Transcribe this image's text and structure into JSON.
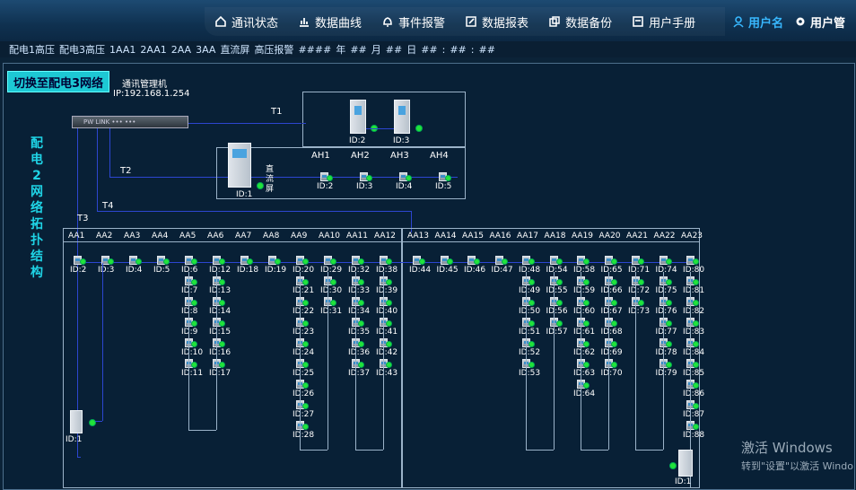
{
  "nav": [
    {
      "label": "通讯状态",
      "icon": "home-icon"
    },
    {
      "label": "数据曲线",
      "icon": "chart-icon"
    },
    {
      "label": "事件报警",
      "icon": "bell-icon"
    },
    {
      "label": "数据报表",
      "icon": "edit-icon"
    },
    {
      "label": "数据备份",
      "icon": "copy-icon"
    },
    {
      "label": "用户手册",
      "icon": "book-icon"
    }
  ],
  "user": {
    "name": "用户名",
    "manage": "用户管"
  },
  "subbar": [
    "配电1高压",
    "配电3高压",
    "1AA1",
    "2AA1",
    "2AA",
    "3AA",
    "直流屏",
    "高压报警",
    "####",
    "年",
    "##",
    "月",
    "##",
    "日",
    "##",
    ":",
    "##",
    ":",
    "##"
  ],
  "switch_button": "切换至配电3网络",
  "title_vertical": "配电2网络拓扑结构",
  "comm": {
    "name": "通讯管理机",
    "ip": "IP:192.168.1.254",
    "device_text": "PW LINK ••• •••"
  },
  "trunks": [
    "T1",
    "T2",
    "T3",
    "T4"
  ],
  "t1_cabinets": [
    "ID:2",
    "ID:3"
  ],
  "ah": [
    "AH1",
    "AH2",
    "AH3",
    "AH4"
  ],
  "ah_ids": [
    "ID:2",
    "ID:3",
    "ID:4",
    "ID:5"
  ],
  "dc": {
    "id": "ID:1",
    "label": "直流屏"
  },
  "aa_headers": [
    "AA1",
    "AA2",
    "AA3",
    "AA4",
    "AA5",
    "AA6",
    "AA7",
    "AA8",
    "AA9",
    "AA10",
    "AA11",
    "AA12",
    "AA13",
    "AA14",
    "AA15",
    "AA16",
    "AA17",
    "AA18",
    "AA19",
    "AA20",
    "AA21",
    "AA22",
    "AA23"
  ],
  "aa_columns": [
    [
      "ID:2"
    ],
    [
      "ID:3"
    ],
    [
      "ID:4"
    ],
    [
      "ID:5"
    ],
    [
      "ID:6",
      "ID:7",
      "ID:8",
      "ID:9",
      "ID:10",
      "ID:11"
    ],
    [
      "ID:12",
      "ID:13",
      "ID:14",
      "ID:15",
      "ID:16",
      "ID:17"
    ],
    [
      "ID:18"
    ],
    [
      "ID:19"
    ],
    [
      "ID:20",
      "ID:21",
      "ID:22",
      "ID:23",
      "ID:24",
      "ID:25",
      "ID:26",
      "ID:27",
      "ID:28"
    ],
    [
      "ID:29",
      "ID:30",
      "ID:31"
    ],
    [
      "ID:32",
      "ID:33",
      "ID:34",
      "ID:35",
      "ID:36",
      "ID:37"
    ],
    [
      "ID:38",
      "ID:39",
      "ID:40",
      "ID:41",
      "ID:42",
      "ID:43"
    ],
    [
      "ID:44"
    ],
    [
      "ID:45"
    ],
    [
      "ID:46"
    ],
    [
      "ID:47"
    ],
    [
      "ID:48",
      "ID:49",
      "ID:50",
      "ID:51",
      "ID:52",
      "ID:53"
    ],
    [
      "ID:54",
      "ID:55",
      "ID:56",
      "ID:57"
    ],
    [
      "ID:58",
      "ID:59",
      "ID:60",
      "ID:61",
      "ID:62",
      "ID:63",
      "ID:64"
    ],
    [
      "ID:65",
      "ID:66",
      "ID:67",
      "ID:68",
      "ID:69",
      "ID:70"
    ],
    [
      "ID:71",
      "ID:72",
      "ID:73"
    ],
    [
      "ID:74",
      "ID:75",
      "ID:76",
      "ID:77",
      "ID:78",
      "ID:79"
    ],
    [
      "ID:80",
      "ID:81",
      "ID:82",
      "ID:83",
      "ID:84",
      "ID:85",
      "ID:86",
      "ID:87",
      "ID:88"
    ]
  ],
  "left_meter_id": "ID:1",
  "right_meter_id": "ID:1",
  "watermark": {
    "line1": "激活 Windows",
    "line2": "转到\"设置\"以激活 Windo"
  }
}
